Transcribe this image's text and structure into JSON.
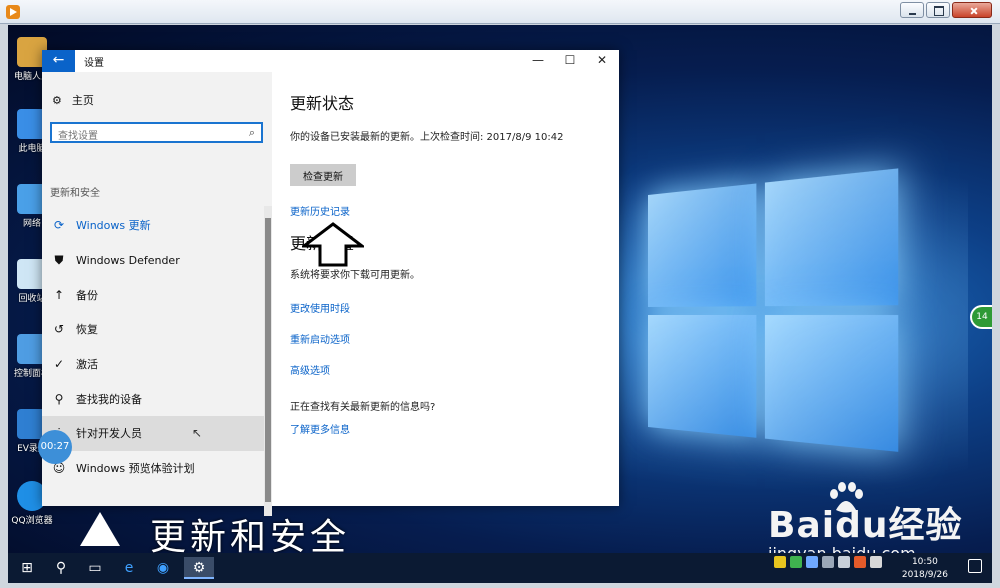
{
  "player": {
    "controls": [
      "minimize",
      "maximize",
      "close"
    ]
  },
  "desktop": {
    "icons": [
      {
        "label": "电脑人人",
        "icon": "user-folder-icon",
        "color": "#d9a441"
      },
      {
        "label": "此电脑",
        "icon": "computer-icon",
        "color": "#3a8ee6"
      },
      {
        "label": "网络",
        "icon": "network-icon",
        "color": "#4aa0e8"
      },
      {
        "label": "回收站",
        "icon": "recycle-bin-icon",
        "color": "#cfe6f5"
      },
      {
        "label": "控制面板",
        "icon": "control-panel-icon",
        "color": "#4f9de3"
      },
      {
        "label": "EV录屏",
        "icon": "ev-recorder-icon",
        "color": "#2f7fd2"
      },
      {
        "label": "QQ浏览器",
        "icon": "qq-browser-icon",
        "color": "#1f8fe6"
      }
    ],
    "side_badge": "14"
  },
  "settings": {
    "window_title": "设置",
    "home_label": "主页",
    "search_placeholder": "查找设置",
    "group_label": "更新和安全",
    "nav_items": [
      {
        "label": "Windows 更新",
        "icon": "refresh-icon"
      },
      {
        "label": "Windows Defender",
        "icon": "shield-icon"
      },
      {
        "label": "备份",
        "icon": "upload-icon"
      },
      {
        "label": "恢复",
        "icon": "history-icon"
      },
      {
        "label": "激活",
        "icon": "check-circle-icon"
      },
      {
        "label": "查找我的设备",
        "icon": "person-location-icon"
      },
      {
        "label": "针对开发人员",
        "icon": "developer-tools-icon"
      },
      {
        "label": "Windows 预览体验计划",
        "icon": "insider-icon"
      }
    ],
    "main": {
      "status_title": "更新状态",
      "status_text": "你的设备已安装最新的更新。上次检查时间: 2017/8/9 10:42",
      "check_button": "检查更新",
      "history_link": "更新历史记录",
      "settings_title": "更新设置",
      "settings_text": "系统将要求你下载可用更新。",
      "links": [
        "更改使用时段",
        "重新启动选项",
        "高级选项"
      ],
      "info_question": "正在查找有关最新更新的信息吗?",
      "learn_more": "了解更多信息"
    }
  },
  "overlay": {
    "timer": "00:27",
    "caption": "更新和安全",
    "watermark_brand": "Baidu经验",
    "watermark_url": "jingyan.baidu.com"
  },
  "taskbar": {
    "clock_time": "10:50",
    "clock_date": "2018/9/26"
  }
}
